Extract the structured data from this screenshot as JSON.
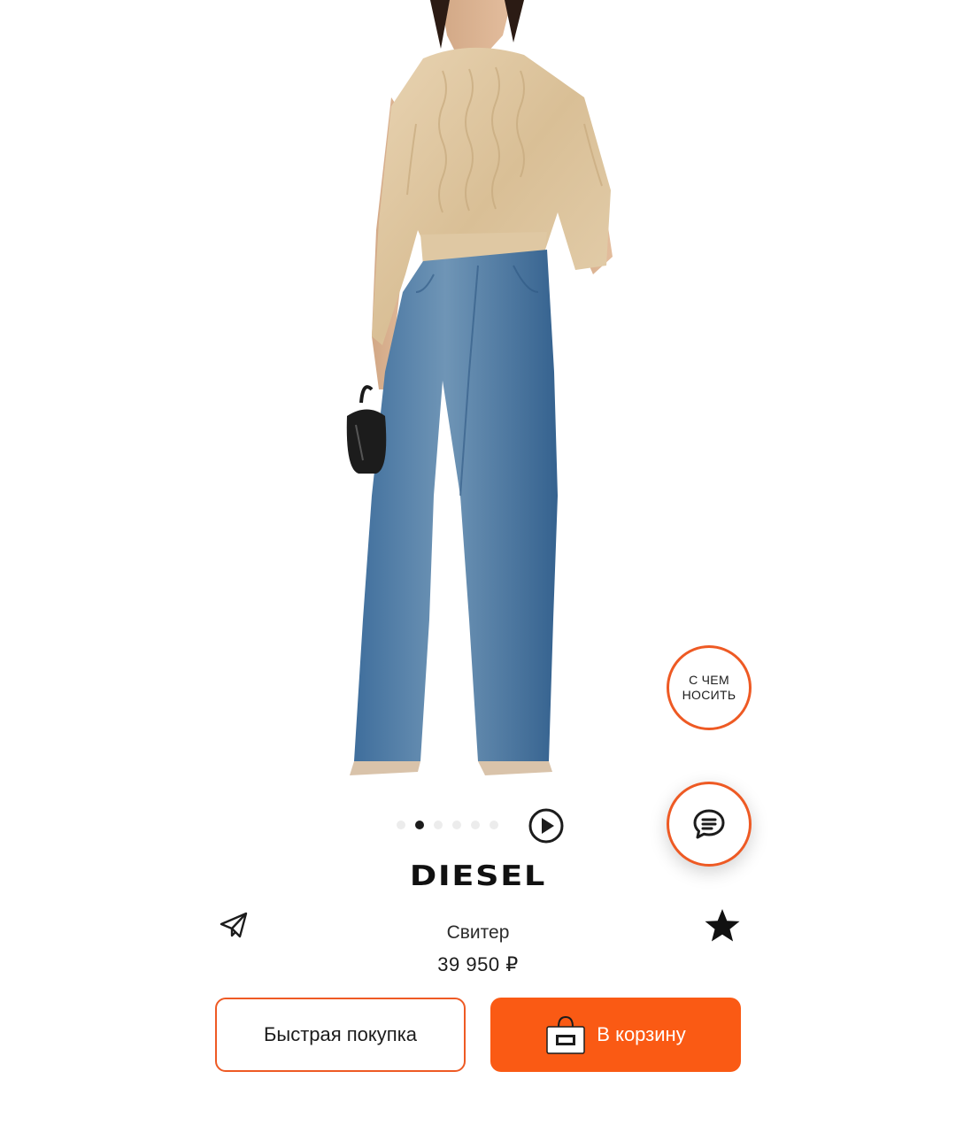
{
  "product": {
    "brand": "DIESEL",
    "name": "Свитер",
    "price": "39 950 ₽"
  },
  "gallery": {
    "image": "product-photo-model-sweater-jeans",
    "total_images": 6,
    "current_index": 2
  },
  "floating": {
    "outfit_label": "С ЧЕМ\nНОСИТЬ",
    "chat_icon": "chat-bubble-icon"
  },
  "actions": {
    "quick_buy_label": "Быстрая покупка",
    "add_to_cart_label": "В корзину",
    "share_icon": "paper-plane-icon",
    "favorite_icon": "star-icon",
    "play_icon": "play-icon",
    "cart_icon": "shopping-bag-icon"
  },
  "colors": {
    "accent": "#fa5a14",
    "accent_border": "#ee5a24",
    "text": "#1c1c1c"
  }
}
